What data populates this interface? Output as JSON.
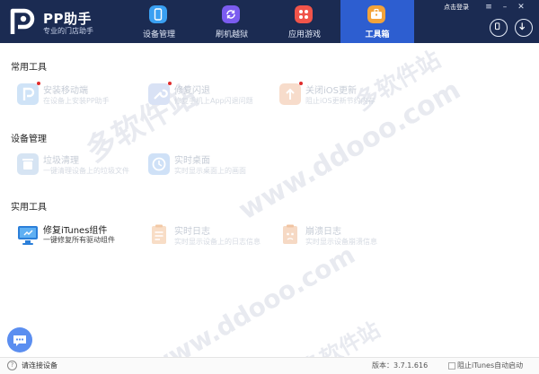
{
  "app": {
    "name": "PP助手",
    "slogan": "专业的门店助手"
  },
  "header": {
    "tabs": [
      {
        "label": "设备管理",
        "icon": "phone-icon",
        "color": "#3aa0f2"
      },
      {
        "label": "刷机越狱",
        "icon": "refresh-icon",
        "color": "#7b5cf0"
      },
      {
        "label": "应用游戏",
        "icon": "apps-icon",
        "color": "#f0544a"
      },
      {
        "label": "工具箱",
        "icon": "toolbox-icon",
        "color": "#f3a33a",
        "active": true
      }
    ],
    "login_label": "点击登录",
    "window_controls": [
      "menu-icon",
      "minimize-icon",
      "close-icon"
    ],
    "side_buttons": [
      "device-icon",
      "download-icon"
    ]
  },
  "sections": [
    {
      "title": "常用工具",
      "tools": [
        {
          "name": "安装移动端",
          "desc": "在设备上安装PP助手",
          "icon": "pp-install-icon",
          "dot": true
        },
        {
          "name": "修复闪退",
          "desc": "修复手机上App闪退问题",
          "icon": "wrench-icon",
          "dot": true
        },
        {
          "name": "关闭iOS更新",
          "desc": "阻止iOS更新节约内存",
          "icon": "upload-block-icon",
          "dot": true
        }
      ]
    },
    {
      "title": "设备管理",
      "tools": [
        {
          "name": "垃圾清理",
          "desc": "一键清理设备上的垃圾文件",
          "icon": "trash-icon"
        },
        {
          "name": "实时桌面",
          "desc": "实时显示桌面上的画面",
          "icon": "clock-icon"
        }
      ]
    },
    {
      "title": "实用工具",
      "tools": [
        {
          "name": "修复iTunes组件",
          "desc": "一键修复所有驱动组件",
          "icon": "itunes-repair-icon"
        },
        {
          "name": "实时日志",
          "desc": "实时显示设备上的日志信息",
          "icon": "log-icon"
        },
        {
          "name": "崩溃日志",
          "desc": "实时显示设备崩溃信息",
          "icon": "crash-log-icon"
        }
      ]
    }
  ],
  "watermark": {
    "url": "www.ddooo.com",
    "text": "多软件站"
  },
  "footer": {
    "status": "请连接设备",
    "version": "版本：3.7.1.616",
    "itunes_option": "阻止iTunes自动启动"
  },
  "colors": {
    "header_bg": "#1b2b52",
    "active_tab": "#2d5ed0",
    "accent": "#5b8ef0",
    "badge_dot": "#e02c2c"
  }
}
